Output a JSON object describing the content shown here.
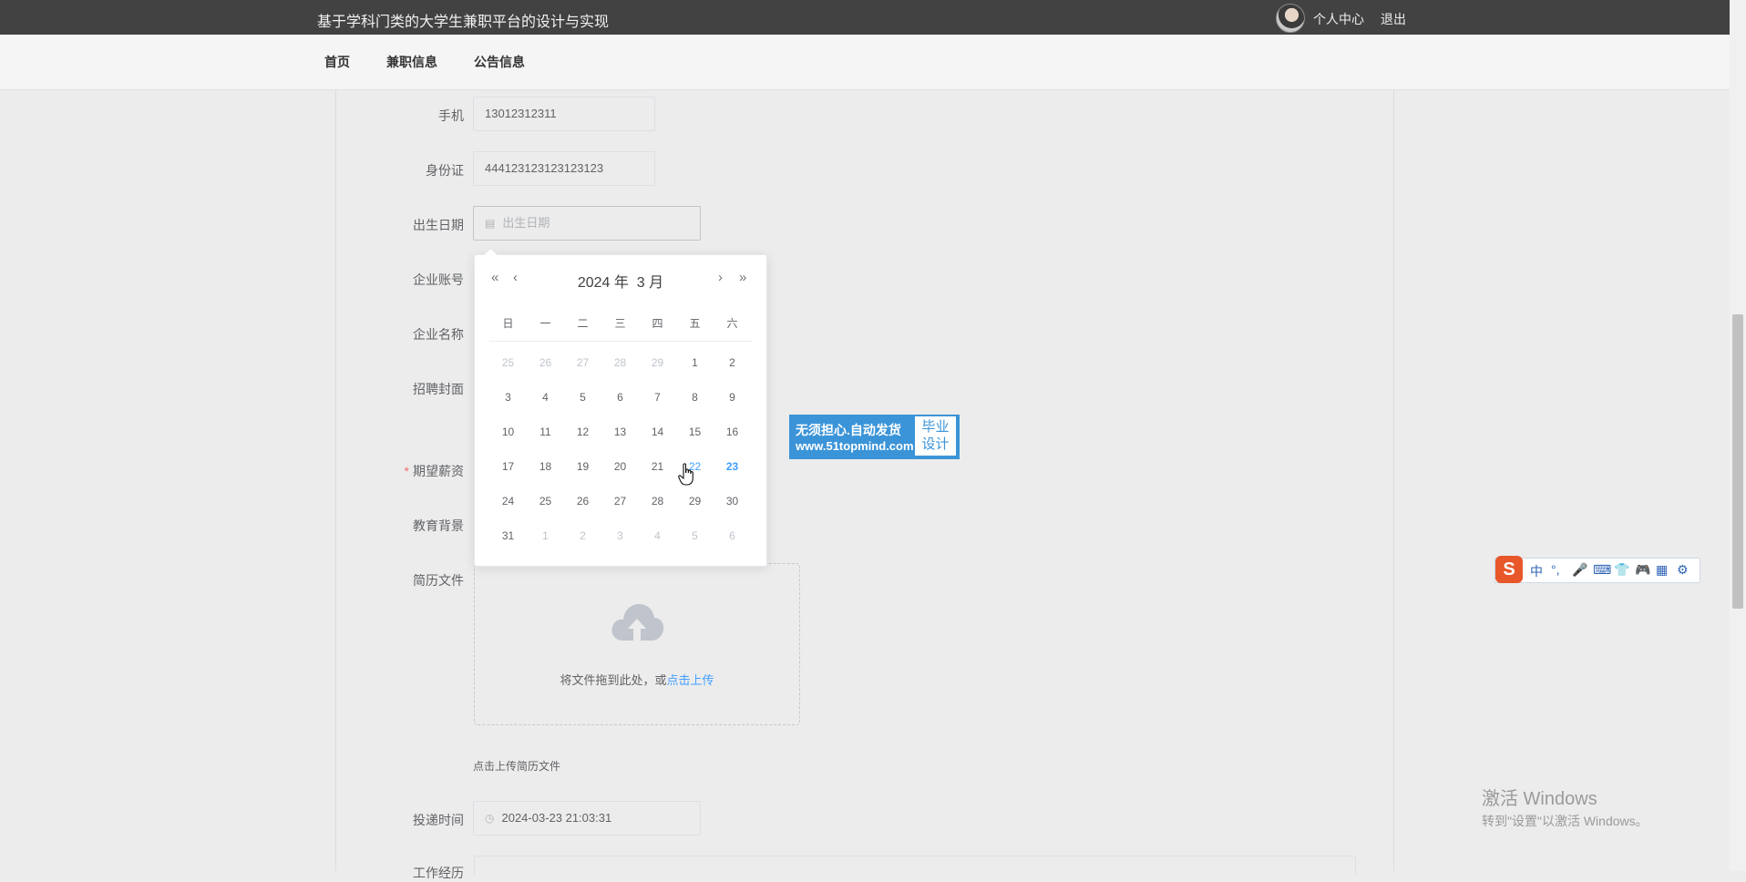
{
  "header": {
    "title": "基于学科门类的大学生兼职平台的设计与实现",
    "user_center": "个人中心",
    "logout": "退出"
  },
  "nav": {
    "items": [
      "首页",
      "兼职信息",
      "公告信息"
    ]
  },
  "form": {
    "phone": {
      "label": "手机",
      "value": "13012312311"
    },
    "id_card": {
      "label": "身份证",
      "value": "444123123123123123"
    },
    "birthday": {
      "label": "出生日期",
      "placeholder": "出生日期"
    },
    "company_account": {
      "label": "企业账号"
    },
    "company_name": {
      "label": "企业名称"
    },
    "cover": {
      "label": "招聘封面"
    },
    "salary": {
      "label": "期望薪资",
      "required_mark": "*"
    },
    "education": {
      "label": "教育背景"
    },
    "resume": {
      "label": "简历文件",
      "upload_text": "将文件拖到此处，或",
      "upload_link": "点击上传",
      "hint": "点击上传简历文件"
    },
    "submit_time": {
      "label": "投递时间",
      "value": "2024-03-23 21:03:31"
    },
    "work_exp": {
      "label": "工作经历"
    }
  },
  "calendar": {
    "prev_year": "«",
    "prev_month": "‹",
    "next_month": "›",
    "next_year": "»",
    "year_label": "2024 年",
    "month_label": "3 月",
    "weekdays": [
      "日",
      "一",
      "二",
      "三",
      "四",
      "五",
      "六"
    ],
    "days": [
      [
        "25",
        "26",
        "27",
        "28",
        "29",
        "1",
        "2"
      ],
      [
        "3",
        "4",
        "5",
        "6",
        "7",
        "8",
        "9"
      ],
      [
        "10",
        "11",
        "12",
        "13",
        "14",
        "15",
        "16"
      ],
      [
        "17",
        "18",
        "19",
        "20",
        "21",
        "22",
        "23"
      ],
      [
        "24",
        "25",
        "26",
        "27",
        "28",
        "29",
        "30"
      ],
      [
        "31",
        "1",
        "2",
        "3",
        "4",
        "5",
        "6"
      ]
    ],
    "today": "23",
    "hovered": "22"
  },
  "watermark": {
    "line1": "无须担心.自动发货",
    "line2": "www.51topmind.com",
    "right1": "毕业",
    "right2": "设计"
  },
  "ime": {
    "logo": "S",
    "items": [
      "中",
      "°,",
      "🎤",
      "⌨",
      "👕",
      "🎮",
      "▦",
      "⚙"
    ]
  },
  "windows_activation": {
    "line1": "激活 Windows",
    "line2": "转到\"设置\"以激活 Windows。"
  }
}
